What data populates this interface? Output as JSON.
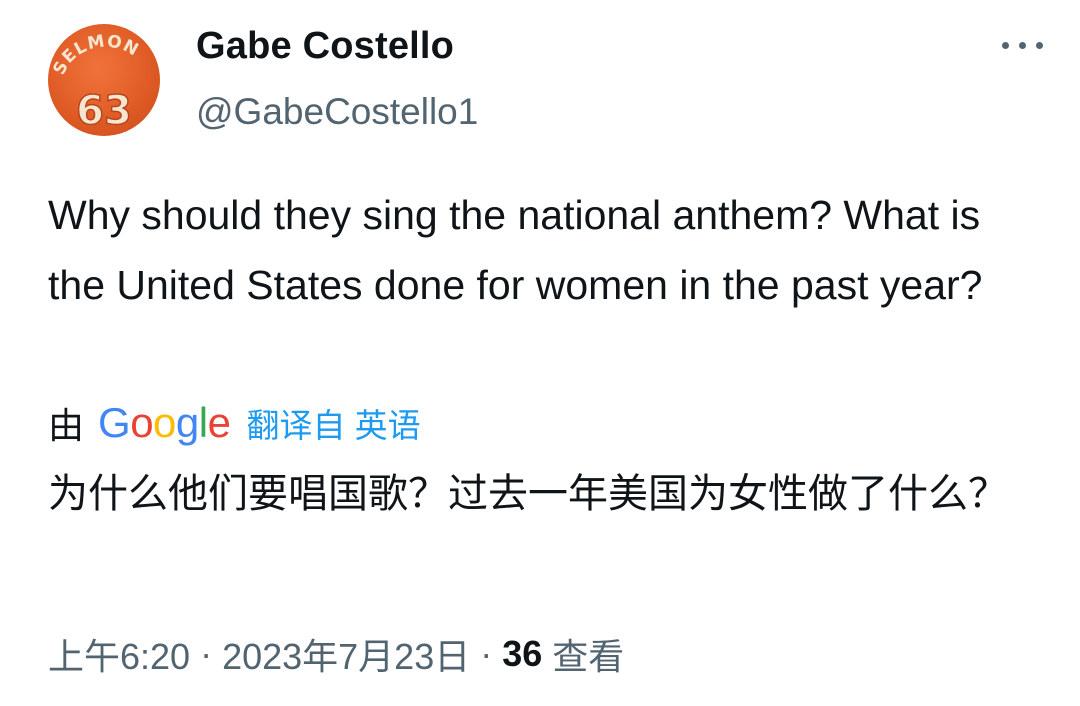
{
  "author": {
    "display_name": "Gabe Costello",
    "handle": "@GabeCostello1",
    "avatar_text_top": "SELMON",
    "avatar_number": "63"
  },
  "tweet": {
    "text": "Why should they sing the national anthem? What is the United States done for women in the past year?",
    "translation_by": "由",
    "translation_provider": "Google",
    "translation_link": "翻译自 英语",
    "translated_text": "为什么他们要唱国歌？过去一年美国为女性做了什么？"
  },
  "meta": {
    "time": "上午6:20",
    "separator": "·",
    "date": "2023年7月23日",
    "views_count": "36",
    "views_label": "查看"
  },
  "icons": {
    "more": "more-horizontal-icon"
  },
  "colors": {
    "text_primary": "#0f1419",
    "text_secondary": "#536471",
    "link": "#1d9bf0",
    "avatar_bg": "#de5a24"
  }
}
